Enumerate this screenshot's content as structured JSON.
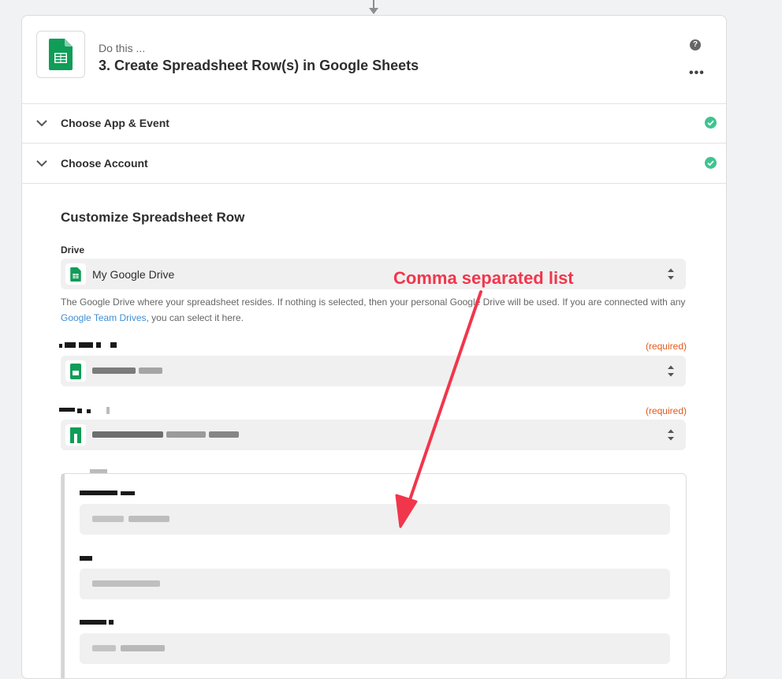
{
  "step": {
    "subtitle": "Do this ...",
    "title": "3. Create Spreadsheet Row(s) in Google Sheets",
    "help_icon": "?",
    "more_icon": "•••"
  },
  "sections": [
    {
      "label": "Choose App & Event",
      "status": "complete"
    },
    {
      "label": "Choose Account",
      "status": "complete"
    }
  ],
  "customize": {
    "title": "Customize Spreadsheet Row",
    "drive_label": "Drive",
    "drive_value": "My Google Drive",
    "drive_help_prefix": "The Google Drive where your spreadsheet resides. If nothing is selected, then your personal Google Drive will be used. If you are connected with any ",
    "drive_help_link": "Google Team Drives",
    "drive_help_suffix": ", you can select it here.",
    "required_text": "(required)"
  },
  "annotation": {
    "text": "Comma separated list",
    "color": "#f1364c"
  },
  "colors": {
    "sheets_green": "#0f9d58",
    "check_green": "#3fc48f",
    "required": "#e35a1a",
    "link": "#3e8fd6"
  }
}
